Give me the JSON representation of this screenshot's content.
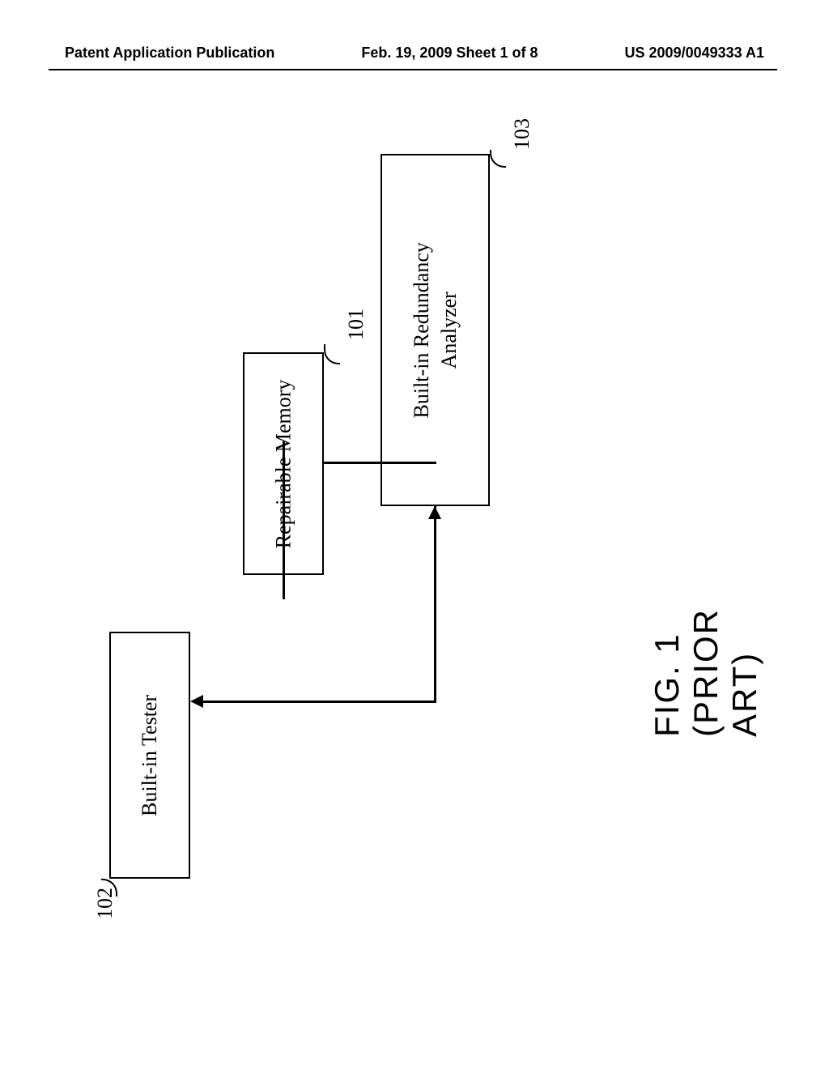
{
  "header": {
    "left": "Patent Application Publication",
    "center": "Feb. 19, 2009  Sheet 1 of 8",
    "right": "US 2009/0049333 A1"
  },
  "blocks": {
    "memory": {
      "label": "Repairable Memory",
      "ref": "101"
    },
    "tester": {
      "label": "Built-in Tester",
      "ref": "102"
    },
    "analyzer": {
      "label_line1": "Built-in Redundancy",
      "label_line2": "Analyzer",
      "ref": "103"
    }
  },
  "figure_label": "FIG. 1 (PRIOR ART)"
}
